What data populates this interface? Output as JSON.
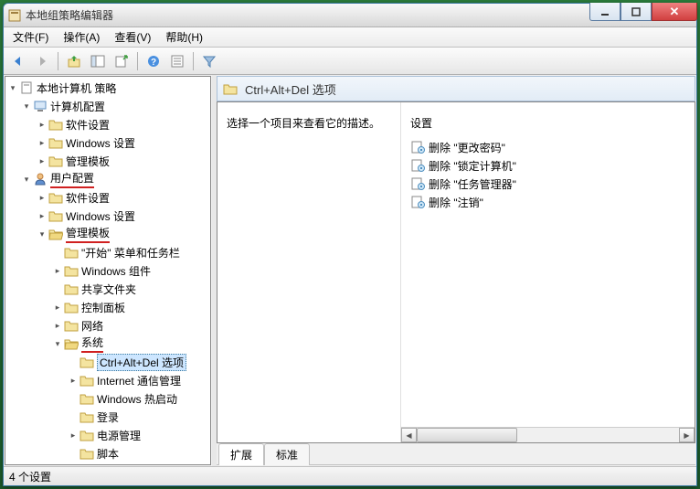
{
  "window": {
    "title": "本地组策略编辑器"
  },
  "menus": [
    "文件(F)",
    "操作(A)",
    "查看(V)",
    "帮助(H)"
  ],
  "tree": {
    "root": {
      "label": "本地计算机 策略"
    },
    "comp_config": "计算机配置",
    "comp_soft": "软件设置",
    "comp_win": "Windows 设置",
    "comp_tmpl": "管理模板",
    "user_config": "用户配置",
    "user_soft": "软件设置",
    "user_win": "Windows 设置",
    "user_tmpl": "管理模板",
    "start_task": "\"开始\" 菜单和任务栏",
    "win_comp": "Windows 组件",
    "shared": "共享文件夹",
    "ctrlpanel": "控制面板",
    "network": "网络",
    "system": "系统",
    "cad": "Ctrl+Alt+Del 选项",
    "inetmgmt": "Internet 通信管理",
    "winhot": "Windows 热启动",
    "logon": "登录",
    "power": "电源管理",
    "scripts": "脚本"
  },
  "header": {
    "title": "Ctrl+Alt+Del 选项"
  },
  "desc": "选择一个项目来查看它的描述。",
  "settings_col": "设置",
  "policies": [
    "删除 \"更改密码\"",
    "删除 \"锁定计算机\"",
    "删除 \"任务管理器\"",
    "删除 \"注销\""
  ],
  "tabs": {
    "ext": "扩展",
    "std": "标准"
  },
  "status": "4 个设置"
}
